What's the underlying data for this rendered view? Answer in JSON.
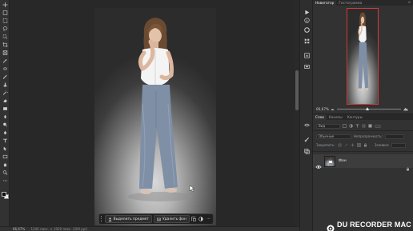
{
  "toolbar": {
    "tools": [
      {
        "name": "move-tool-icon",
        "label": "move"
      },
      {
        "name": "artboard-tool-icon",
        "label": "artboard"
      },
      {
        "name": "marquee-tool-icon",
        "label": "marquee"
      },
      {
        "name": "lasso-tool-icon",
        "label": "lasso"
      },
      {
        "name": "object-select-tool-icon",
        "label": "object-select"
      },
      {
        "name": "crop-tool-icon",
        "label": "crop"
      },
      {
        "name": "frame-tool-icon",
        "label": "frame"
      },
      {
        "name": "eyedropper-tool-icon",
        "label": "eyedropper"
      },
      {
        "name": "healing-brush-tool-icon",
        "label": "healing"
      },
      {
        "name": "brush-tool-icon",
        "label": "brush"
      },
      {
        "name": "clone-stamp-tool-icon",
        "label": "clone-stamp"
      },
      {
        "name": "history-brush-tool-icon",
        "label": "history-brush"
      },
      {
        "name": "eraser-tool-icon",
        "label": "eraser"
      },
      {
        "name": "gradient-tool-icon",
        "label": "gradient"
      },
      {
        "name": "blur-tool-icon",
        "label": "blur"
      },
      {
        "name": "dodge-tool-icon",
        "label": "dodge"
      },
      {
        "name": "pen-tool-icon",
        "label": "pen"
      },
      {
        "name": "type-tool-icon",
        "label": "type"
      },
      {
        "name": "path-select-tool-icon",
        "label": "path-select"
      },
      {
        "name": "rectangle-tool-icon",
        "label": "rectangle"
      },
      {
        "name": "hand-tool-icon",
        "label": "hand"
      },
      {
        "name": "zoom-tool-icon",
        "label": "zoom"
      },
      {
        "name": "more-tools-icon",
        "label": "more"
      }
    ],
    "colors": {
      "foreground": "#0e0e0e",
      "background": "#f0f0f0"
    }
  },
  "taskbar": {
    "select_subject_label": "Выделить предмет",
    "remove_bg_label": "Удалить фон",
    "more_label": "···"
  },
  "statusbar": {
    "zoom": "66,67%",
    "doc_info": "1240 пикс. × 1920 пикс. (300 ppi)"
  },
  "navigator": {
    "tabs": [
      "Навигатор",
      "Гистограмма"
    ],
    "zoom": "66,67%",
    "view_frame_color": "#d23b3b"
  },
  "layers_panel": {
    "tabs": [
      "Слои",
      "Каналы",
      "Контуры"
    ],
    "filter_placeholder": "Вид",
    "blend_mode": "Обычные",
    "opacity_label": "Непрозрачность:",
    "lock_label": "Закрепить:",
    "fill_label": "Заливка:",
    "layers": [
      {
        "name": "Фон",
        "visible": true,
        "locked": true
      }
    ]
  },
  "watermark": {
    "text": "DU RECORDER MAC"
  }
}
